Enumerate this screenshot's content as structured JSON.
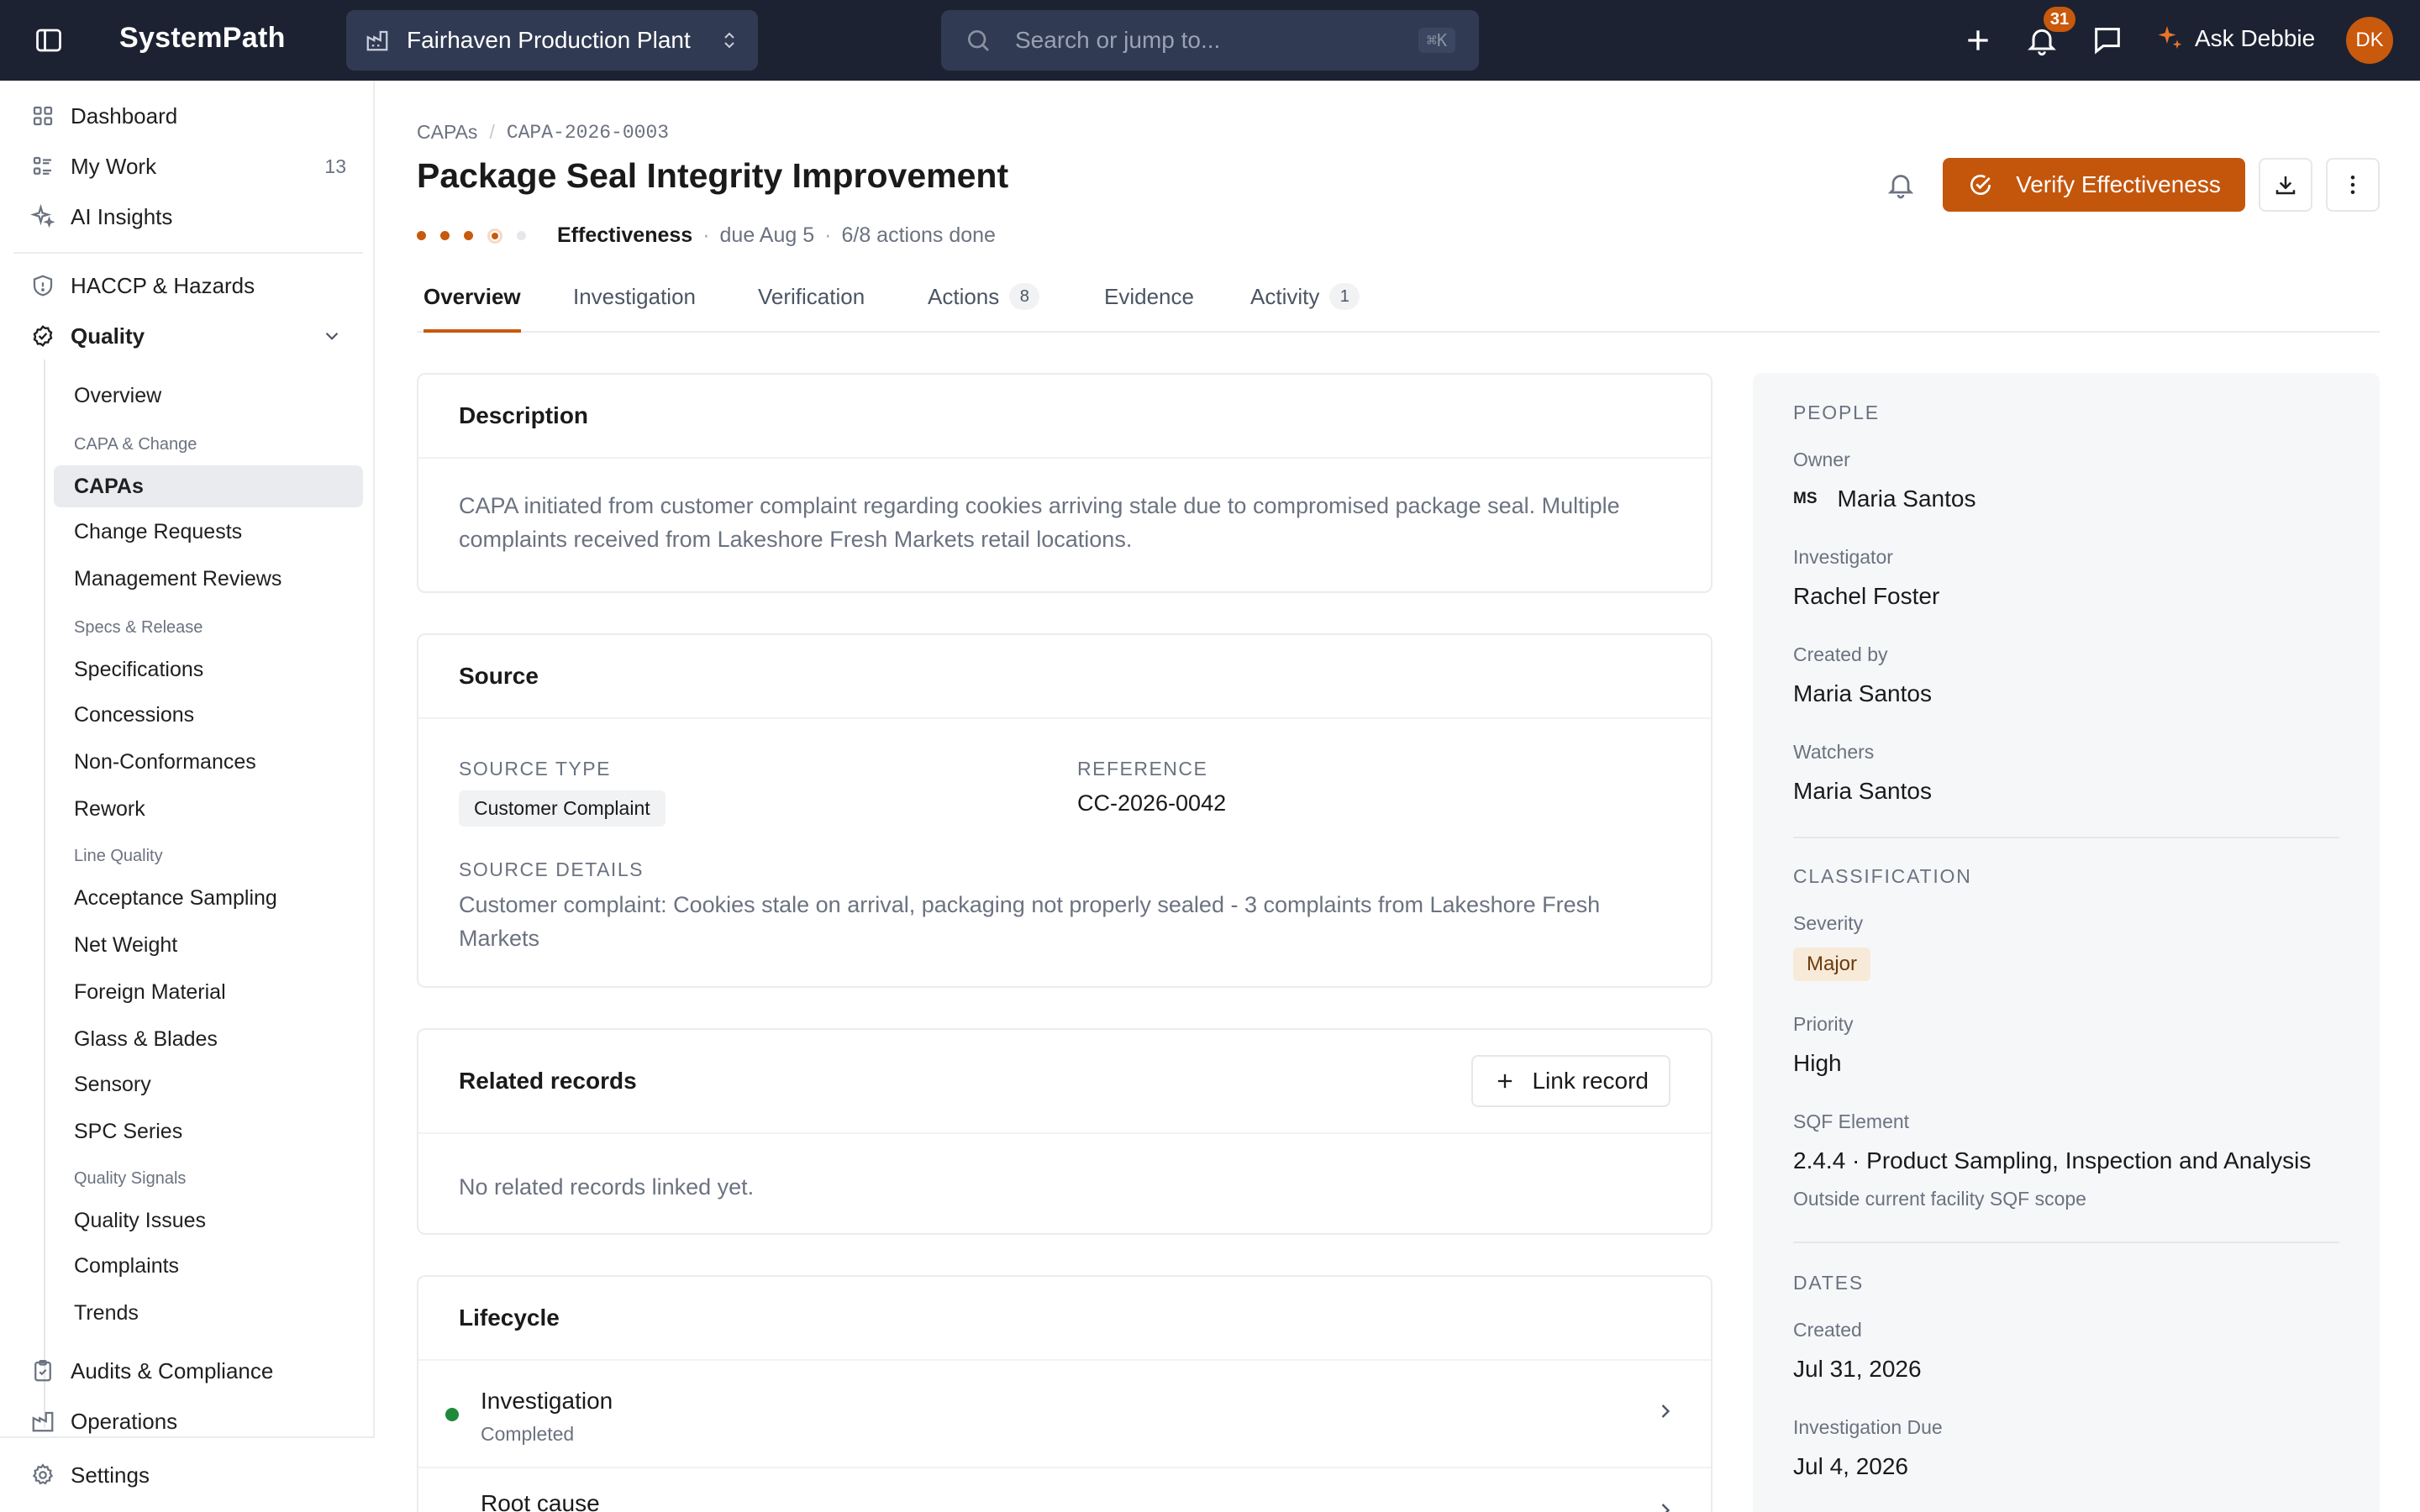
{
  "app": {
    "brand": "SystemPath",
    "facility": "Fairhaven Production Plant",
    "search_placeholder": "Search or jump to...",
    "search_shortcut": "⌘K",
    "notifications_count": "31",
    "ask_label": "Ask Debbie",
    "user_initials": "DK"
  },
  "sidebar": {
    "top": [
      {
        "label": "Dashboard",
        "icon": "grid-icon"
      },
      {
        "label": "My Work",
        "icon": "list-icon",
        "count": "13"
      },
      {
        "label": "AI Insights",
        "icon": "sparkle-icon"
      }
    ],
    "haccp": "HACCP & Hazards",
    "quality": "Quality",
    "quality_overview": "Overview",
    "groups": {
      "capa_change": "CAPA & Change",
      "specs_release": "Specs & Release",
      "line_quality": "Line Quality",
      "quality_signals": "Quality Signals"
    },
    "items": {
      "capas": "CAPAs",
      "change_requests": "Change Requests",
      "management_reviews": "Management Reviews",
      "specifications": "Specifications",
      "concessions": "Concessions",
      "non_conformances": "Non-Conformances",
      "rework": "Rework",
      "acceptance_sampling": "Acceptance Sampling",
      "net_weight": "Net Weight",
      "foreign_material": "Foreign Material",
      "glass_blades": "Glass & Blades",
      "sensory": "Sensory",
      "spc_series": "SPC Series",
      "quality_issues": "Quality Issues",
      "complaints": "Complaints",
      "trends": "Trends"
    },
    "audits": "Audits & Compliance",
    "operations": "Operations",
    "settings": "Settings"
  },
  "page": {
    "breadcrumb_root": "CAPAs",
    "breadcrumb_id": "CAPA-2026-0003",
    "title": "Package Seal Integrity Improvement",
    "stage": "Effectiveness",
    "due": "due Aug 5",
    "progress": "6/8 actions done",
    "verify_label": "Verify Effectiveness"
  },
  "tabs": [
    {
      "label": "Overview"
    },
    {
      "label": "Investigation"
    },
    {
      "label": "Verification"
    },
    {
      "label": "Actions",
      "count": "8"
    },
    {
      "label": "Evidence"
    },
    {
      "label": "Activity",
      "count": "1"
    }
  ],
  "description": {
    "title": "Description",
    "text": "CAPA initiated from customer complaint regarding cookies arriving stale due to compromised package seal. Multiple complaints received from Lakeshore Fresh Markets retail locations."
  },
  "source": {
    "title": "Source",
    "type_label": "SOURCE TYPE",
    "type_value": "Customer Complaint",
    "ref_label": "REFERENCE",
    "ref_value": "CC-2026-0042",
    "details_label": "SOURCE DETAILS",
    "details_value": "Customer complaint: Cookies stale on arrival, packaging not properly sealed - 3 complaints from Lakeshore Fresh Markets"
  },
  "related": {
    "title": "Related records",
    "link_label": "Link record",
    "empty": "No related records linked yet."
  },
  "lifecycle": {
    "title": "Lifecycle",
    "steps": [
      {
        "title": "Investigation",
        "status": "Completed"
      },
      {
        "title": "Root cause",
        "status": ""
      }
    ]
  },
  "panel": {
    "people_title": "PEOPLE",
    "owner_label": "Owner",
    "owner_initials": "MS",
    "owner_name": "Maria Santos",
    "investigator_label": "Investigator",
    "investigator_name": "Rachel Foster",
    "created_by_label": "Created by",
    "created_by_name": "Maria Santos",
    "watchers_label": "Watchers",
    "watchers_name": "Maria Santos",
    "classification_title": "CLASSIFICATION",
    "severity_label": "Severity",
    "severity_value": "Major",
    "priority_label": "Priority",
    "priority_value": "High",
    "sqf_label": "SQF Element",
    "sqf_value": "2.4.4 · Product Sampling, Inspection and Analysis",
    "sqf_note": "Outside current facility SQF scope",
    "dates_title": "DATES",
    "created_label": "Created",
    "created_value": "Jul 31, 2026",
    "inv_due_label": "Investigation Due",
    "inv_due_value": "Jul 4, 2026"
  },
  "colors": {
    "accent": "#c9590c",
    "topbar": "#1c2232",
    "success": "#1f8a3b"
  }
}
